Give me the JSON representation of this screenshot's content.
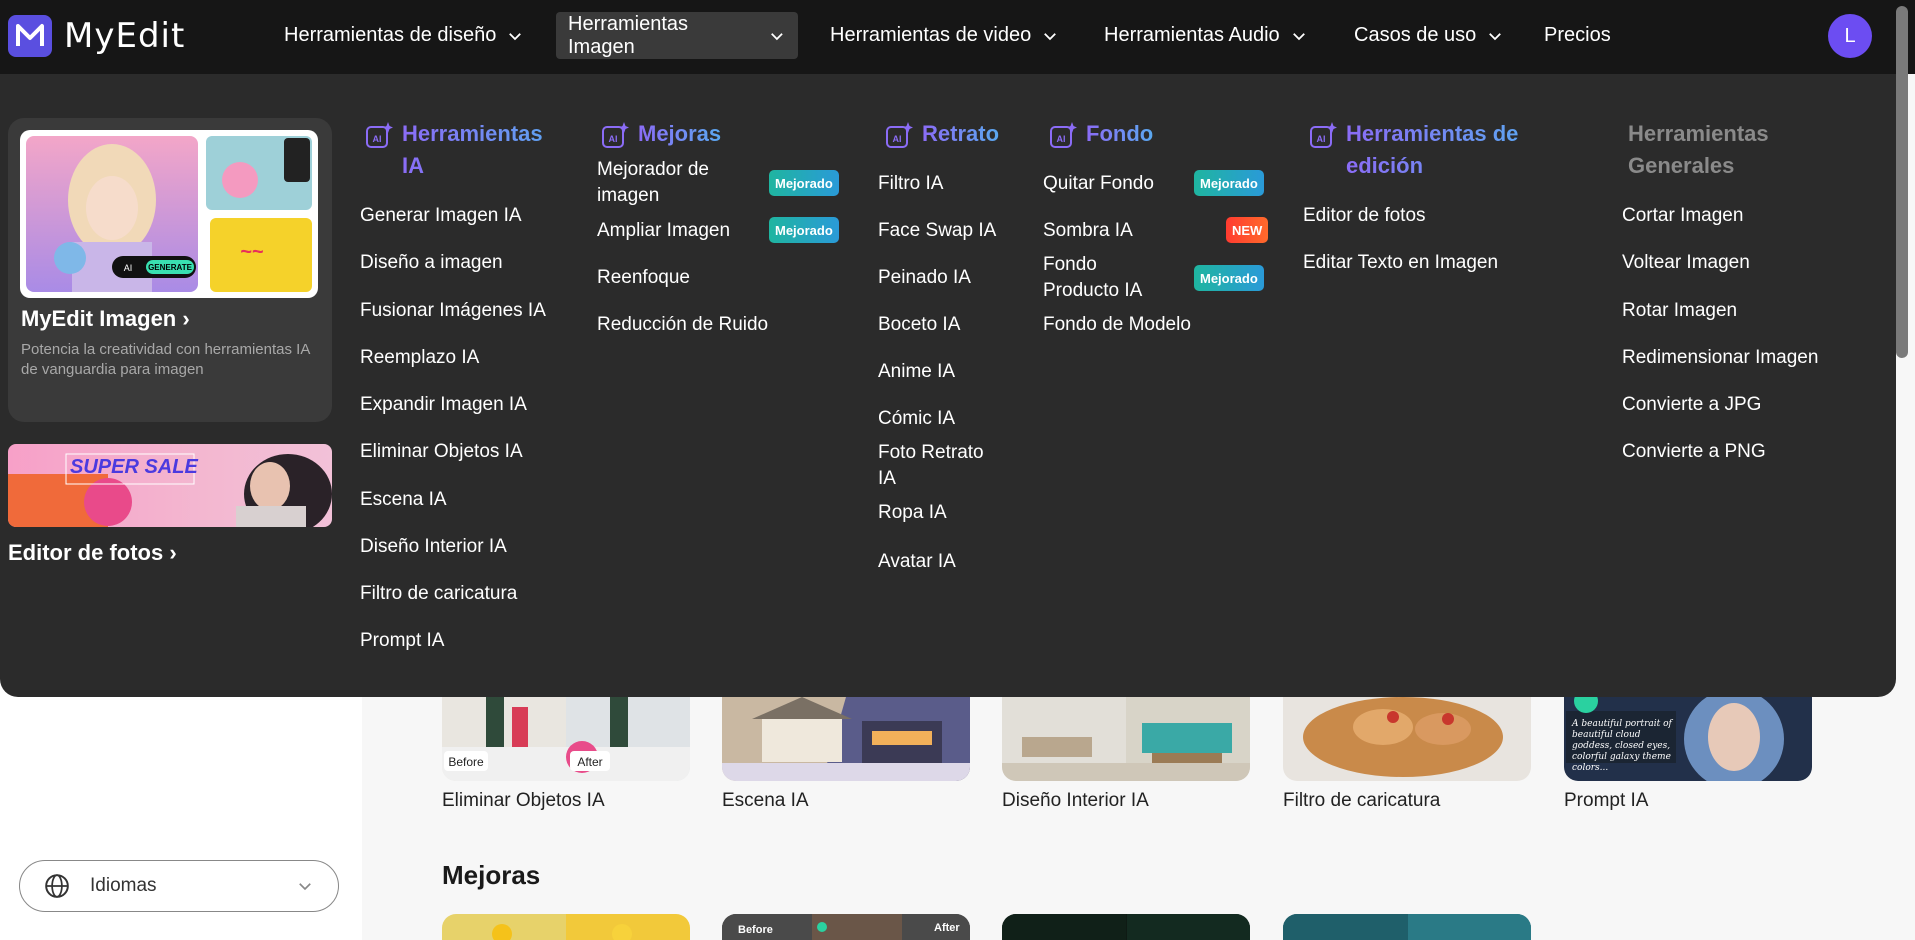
{
  "app": {
    "name": "MyEdit",
    "avatar_letter": "L"
  },
  "nav": {
    "items": [
      {
        "label": "Herramientas de diseño"
      },
      {
        "label": "Herramientas Imagen"
      },
      {
        "label": "Herramientas de video"
      },
      {
        "label": "Herramientas Audio"
      },
      {
        "label": "Casos de uso"
      },
      {
        "label": "Precios"
      }
    ]
  },
  "background": {
    "thumbs": [
      {
        "label": "Eliminar Objetos IA",
        "before": "Before",
        "after": "After"
      },
      {
        "label": "Escena IA"
      },
      {
        "label": "Diseño Interior IA"
      },
      {
        "label": "Filtro de caricatura"
      },
      {
        "label": "Prompt IA",
        "overlay": "A beautiful portrait of beautiful cloud goddess, closed eyes, colorful galaxy theme colors..."
      }
    ],
    "section_title": "Mejoras",
    "row2": {
      "before": "Before",
      "after": "After"
    },
    "language": {
      "label": "Idiomas"
    }
  },
  "menu": {
    "promo": {
      "title": "MyEdit Imagen ›",
      "desc": "Potencia la creatividad con herramientas IA de vanguardia para imagen",
      "generate_label": "GENERATE",
      "ai_label": "AI"
    },
    "promo2": {
      "title": "Editor de fotos ›",
      "banner": "SUPER SALE"
    },
    "columns": {
      "ia": {
        "title": "Herramientas IA",
        "items": [
          "Generar Imagen IA",
          "Diseño a imagen",
          "Fusionar Imágenes IA",
          "Reemplazo IA",
          "Expandir Imagen IA",
          "Eliminar Objetos IA",
          "Escena IA",
          "Diseño Interior IA",
          "Filtro de caricatura",
          "Prompt IA"
        ]
      },
      "mejoras": {
        "title": "Mejoras",
        "items": [
          "Mejorador de imagen",
          "Ampliar Imagen",
          "Reenfoque",
          "Reducción de Ruido"
        ]
      },
      "retrato": {
        "title": "Retrato",
        "items": [
          "Filtro IA",
          "Face Swap IA",
          "Peinado IA",
          "Boceto IA",
          "Anime IA",
          "Cómic IA",
          "Foto Retrato IA",
          "Ropa IA",
          "Avatar IA"
        ]
      },
      "fondo": {
        "title": "Fondo",
        "items": [
          "Quitar Fondo",
          "Sombra IA",
          "Fondo Producto IA",
          "Fondo de Modelo"
        ]
      },
      "edicion": {
        "title": "Herramientas de edición",
        "items": [
          "Editor de fotos",
          "Editar Texto en Imagen"
        ]
      },
      "generales": {
        "title": "Herramientas Generales",
        "items": [
          "Cortar Imagen",
          "Voltear Imagen",
          "Rotar Imagen",
          "Redimensionar Imagen",
          "Convierte a JPG",
          "Convierte a PNG"
        ]
      }
    },
    "badges": {
      "improved": "Mejorado",
      "new": "NEW"
    }
  },
  "colors": {
    "accent": "#6c4df2",
    "menu_bg": "#2b2b2b",
    "nav_bg": "#161616",
    "badge_improved": "#1fb5a0",
    "badge_new": "#ff4a2b"
  }
}
